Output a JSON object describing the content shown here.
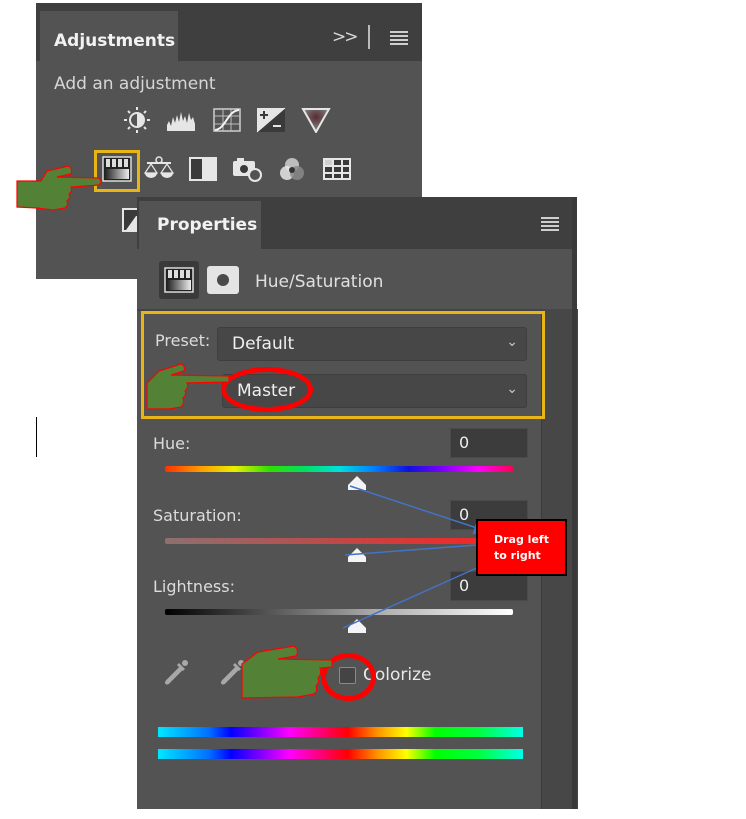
{
  "adjustments_panel": {
    "tab_label": "Adjustments",
    "collapse_label": ">>",
    "subtitle": "Add an adjustment",
    "icons_row1": [
      "brightness-contrast-icon",
      "levels-icon",
      "curves-icon",
      "exposure-icon",
      "vibrance-icon"
    ],
    "icons_row2": [
      "hue-saturation-icon",
      "color-balance-icon",
      "black-white-icon",
      "photo-filter-icon",
      "channel-mixer-icon",
      "color-lookup-icon"
    ],
    "selected_icon": "hue-saturation-icon"
  },
  "properties_panel": {
    "tab_label": "Properties",
    "title": "Hue/Saturation",
    "preset_label": "Preset:",
    "preset_value": "Default",
    "channel_value": "Master",
    "hue": {
      "label": "Hue:",
      "value": "0",
      "slider_fraction": 0.5
    },
    "saturation": {
      "label": "Saturation:",
      "value": "0",
      "slider_fraction": 0.5
    },
    "lightness": {
      "label": "Lightness:",
      "value": "0",
      "slider_fraction": 0.5
    },
    "colorize_label": "Colorize",
    "colorize_checked": false
  },
  "annotations": {
    "drag_note": "Drag left to right",
    "highlight_color": "#e8b516",
    "ellipse_color": "#ff0000",
    "hand_color": "#538135",
    "arrow_color": "#4472c4"
  }
}
